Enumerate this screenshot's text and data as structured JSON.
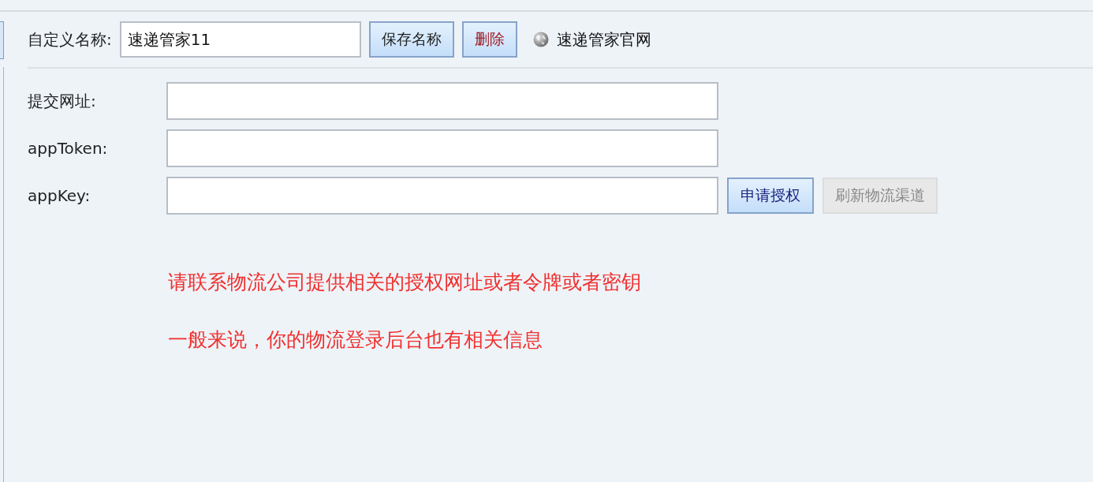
{
  "name_bar": {
    "label": "自定义名称:",
    "value": "速递管家11",
    "buttons": [
      {
        "label": "保存名称",
        "kind": "normal"
      },
      {
        "label": "删除",
        "kind": "danger"
      }
    ],
    "link": {
      "label": "速递管家官网"
    }
  },
  "fields": [
    {
      "label": "提交网址:"
    },
    {
      "label": "appToken:"
    },
    {
      "label": "appKey:"
    }
  ],
  "actions": [
    {
      "label": "申请授权",
      "disabled": false
    },
    {
      "label": "刷新物流渠道",
      "disabled": true
    }
  ],
  "notes": [
    "请联系物流公司提供相关的授权网址或者令牌或者密钥",
    "一般来说，你的物流登录后台也有相关信息"
  ]
}
